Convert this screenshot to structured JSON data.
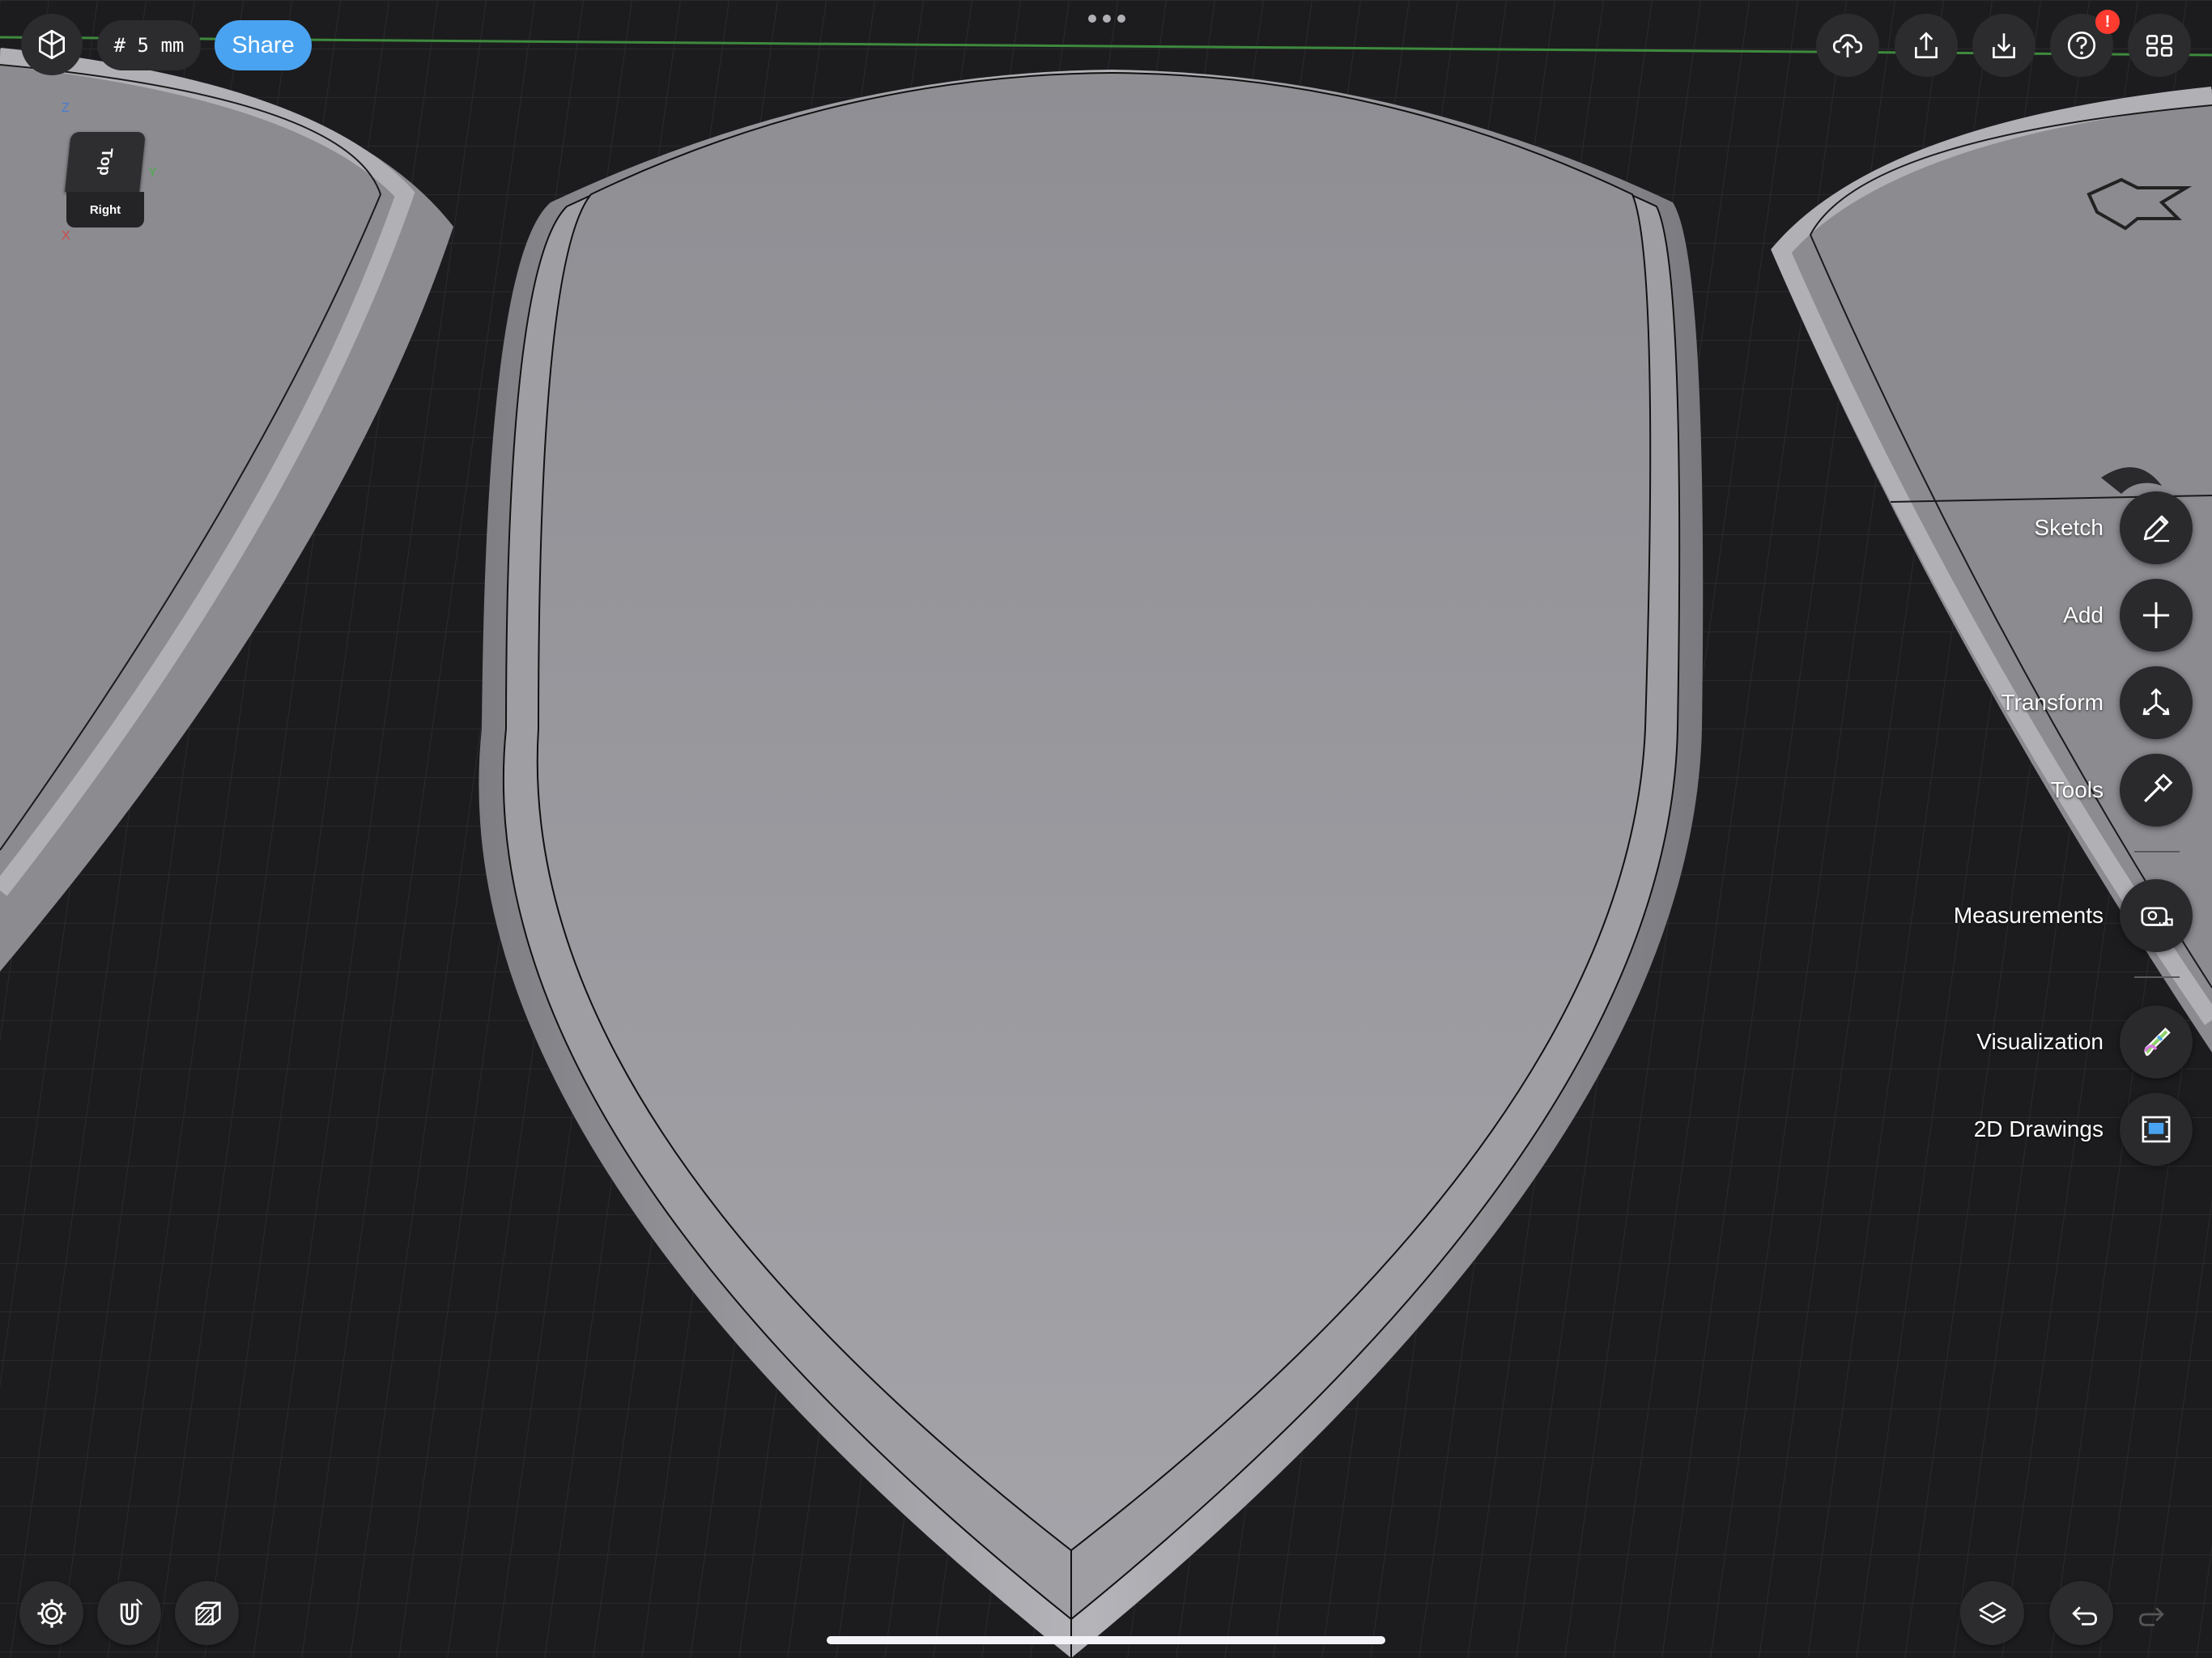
{
  "toolbar_top": {
    "grid_size": "# 5 mm",
    "share_label": "Share",
    "notification_badge": "!"
  },
  "view_cube": {
    "top_label": "Top",
    "right_label": "Right",
    "axis_z": "Z",
    "axis_x": "X",
    "axis_y": "Y"
  },
  "side_menu": {
    "items": [
      {
        "label": "Sketch",
        "icon": "pencil-icon"
      },
      {
        "label": "Add",
        "icon": "plus-icon"
      },
      {
        "label": "Transform",
        "icon": "transform-arrows-icon"
      },
      {
        "label": "Tools",
        "icon": "hammer-icon"
      },
      {
        "label": "Measurements",
        "icon": "tape-measure-icon"
      },
      {
        "label": "Visualization",
        "icon": "paint-brush-icon"
      },
      {
        "label": "2D Drawings",
        "icon": "drawing-sheet-icon"
      }
    ]
  },
  "colors": {
    "background": "#1c1c1e",
    "share_button": "#4aa3f0",
    "badge": "#ff3b30",
    "model_surface": "#9b9ba0",
    "grid_axis_green": "#3d8a3d"
  }
}
